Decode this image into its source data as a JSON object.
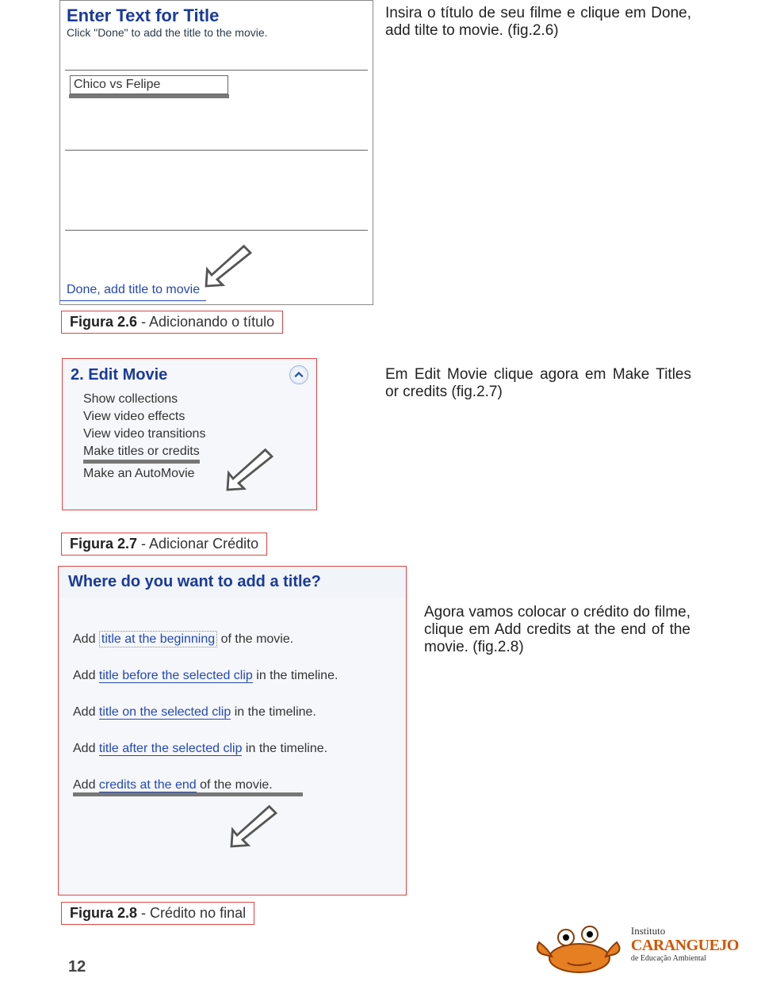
{
  "body_texts": {
    "t1": "Insira o título de seu filme e clique em Done, add tilte to movie. (fig.2.6)",
    "t2": "Em Edit Movie clique agora em Make Titles or credits (fig.2.7)",
    "t3": "Agora vamos colocar o crédito do filme, clique em Add credits at the end of the movie. (fig.2.8)"
  },
  "fig26": {
    "title": "Enter Text for Title",
    "sub": "Click \"Done\" to add the title to the movie.",
    "input_value": "Chico vs Felipe",
    "done_link": "Done, add title to movie",
    "caption_prefix": "Figura 2.6",
    "caption_rest": " - Adicionando o título"
  },
  "fig27": {
    "header": "2. Edit Movie",
    "items": [
      "Show collections",
      "View video effects",
      "View video transitions",
      "Make titles or credits",
      "Make an AutoMovie"
    ],
    "caption_prefix": "Figura 2.7",
    "caption_rest": " - Adicionar Crédito"
  },
  "fig28": {
    "head": "Where do you want to add a title?",
    "items": [
      {
        "link": "title at the beginning",
        "rest": " of the movie.",
        "dotted": true
      },
      {
        "link": "title before the selected clip",
        "rest": " in the timeline."
      },
      {
        "link": "title on the selected clip",
        "rest": " in the timeline."
      },
      {
        "link": "title after the selected clip",
        "rest": " in the timeline."
      },
      {
        "link": "credits at the end",
        "rest": " of the movie."
      }
    ],
    "caption_prefix": "Figura 2.8",
    "caption_rest": " - Crédito no final"
  },
  "page_number": "12",
  "logo": {
    "l1": "Instituto",
    "l2": "CARANGUEJO",
    "l3": "de Educação Ambiental"
  }
}
